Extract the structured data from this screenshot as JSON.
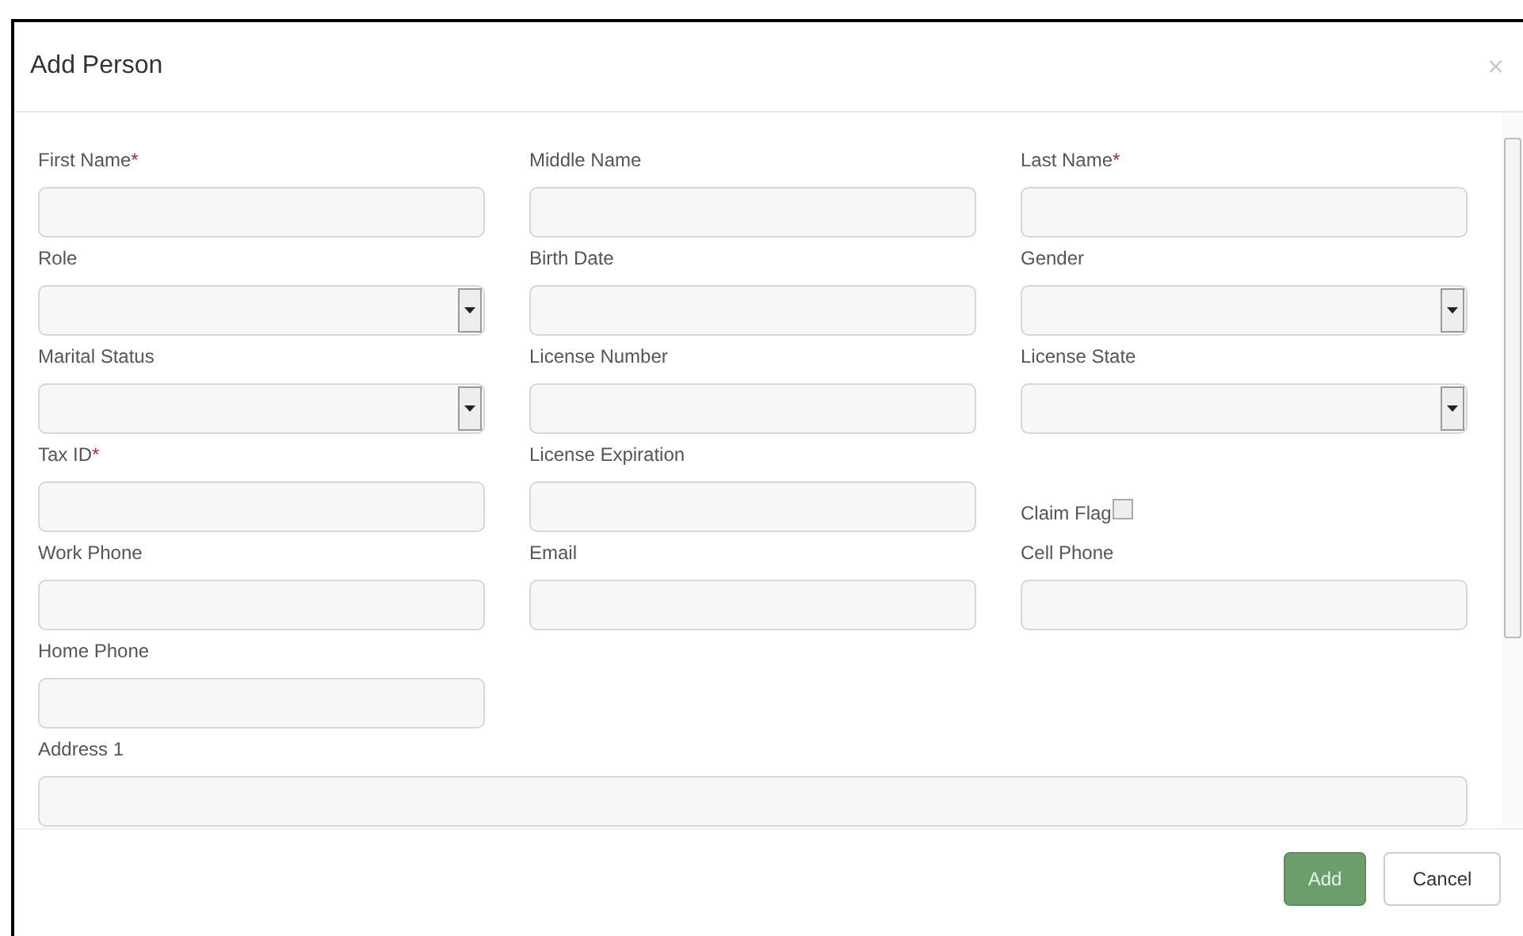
{
  "dialog": {
    "title": "Add Person",
    "close": "×"
  },
  "rows": [
    [
      {
        "kind": "text",
        "label": "First Name",
        "required_mark": "*"
      },
      {
        "kind": "text",
        "label": "Middle Name"
      },
      {
        "kind": "text",
        "label": "Last Name",
        "required_mark": "*"
      }
    ],
    [
      {
        "kind": "select",
        "label": "Role"
      },
      {
        "kind": "text",
        "label": "Birth Date"
      },
      {
        "kind": "select",
        "label": "Gender"
      }
    ],
    [
      {
        "kind": "select",
        "label": "Marital Status"
      },
      {
        "kind": "text",
        "label": "License Number"
      },
      {
        "kind": "select",
        "label": "License State"
      }
    ],
    [
      {
        "kind": "text",
        "label": "Tax ID",
        "required_mark": "*"
      },
      {
        "kind": "text",
        "label": "License Expiration"
      },
      {
        "kind": "checkbox",
        "label": "Claim Flag",
        "checked": false
      }
    ],
    [
      {
        "kind": "text",
        "label": "Work Phone"
      },
      {
        "kind": "text",
        "label": "Email"
      },
      {
        "kind": "text",
        "label": "Cell Phone"
      }
    ],
    [
      {
        "kind": "text",
        "label": "Home Phone"
      }
    ],
    [
      {
        "kind": "wide",
        "label": "Address 1"
      }
    ]
  ],
  "buttons": [
    {
      "kind": "primary",
      "label": "Add"
    },
    {
      "kind": "secondary",
      "label": "Cancel"
    }
  ]
}
